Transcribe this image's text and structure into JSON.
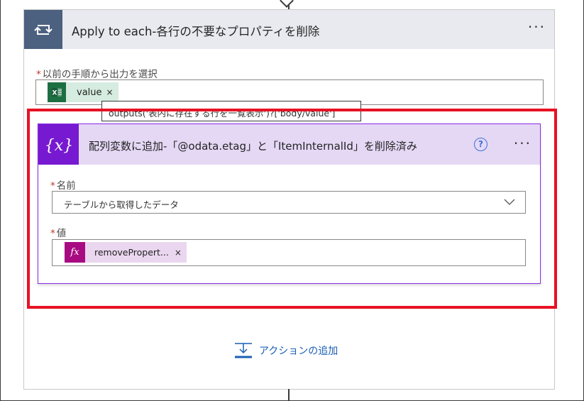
{
  "loop": {
    "title": "Apply to each-各行の不要なプロパティを削除",
    "more": "···",
    "select_label": "以前の手順から出力を選択",
    "required_mark": "*",
    "token": {
      "label": "value",
      "remove": "×",
      "icon": "excel-icon"
    },
    "tooltip": "outputs('表内に存在する行を一覧表示')?['body/value']"
  },
  "action": {
    "title": "配列変数に追加-「@odata.etag」と「ItemInternalId」を削除済み",
    "help": "?",
    "more": "···",
    "name_label": "名前",
    "name_value": "テーブルから取得したデータ",
    "value_label": "値",
    "value_token": {
      "icon_text": "fx",
      "label": "removePropert...",
      "remove": "×"
    }
  },
  "add_action": {
    "label": "アクションの追加"
  },
  "colors": {
    "loop_header_bg": "#e8eaef",
    "loop_icon_bg": "#4c6080",
    "action_header_bg": "#e5d8f5",
    "action_icon_bg": "#7719d1",
    "highlight": "#e81123",
    "link": "#1a5fb4"
  }
}
